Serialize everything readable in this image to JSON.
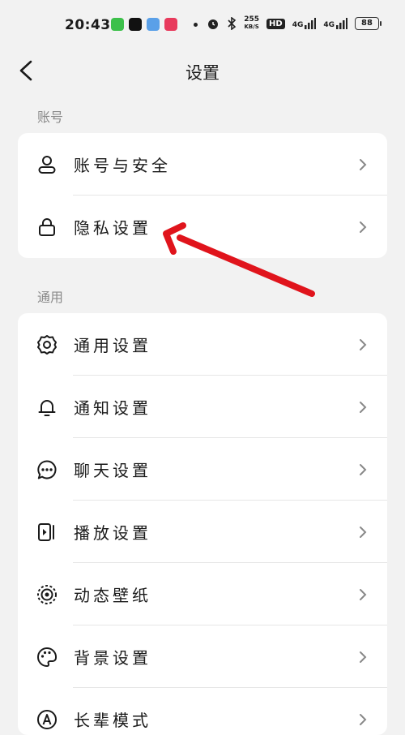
{
  "status_bar": {
    "time": "20:43",
    "net_speed_top": "255",
    "net_speed_bottom": "KB/S",
    "hd_label": "HD",
    "signal1": "4G",
    "signal2": "4G",
    "battery": "88"
  },
  "nav": {
    "title": "设置"
  },
  "sections": [
    {
      "label": "账号",
      "items": [
        {
          "label": "账号与安全",
          "icon": "person-icon"
        },
        {
          "label": "隐私设置",
          "icon": "lock-icon"
        }
      ]
    },
    {
      "label": "通用",
      "items": [
        {
          "label": "通用设置",
          "icon": "gear-icon"
        },
        {
          "label": "通知设置",
          "icon": "bell-icon"
        },
        {
          "label": "聊天设置",
          "icon": "chat-icon"
        },
        {
          "label": "播放设置",
          "icon": "play-panel-icon"
        },
        {
          "label": "动态壁纸",
          "icon": "target-icon"
        },
        {
          "label": "背景设置",
          "icon": "palette-icon"
        },
        {
          "label": "长辈模式",
          "icon": "a-circle-icon"
        }
      ]
    }
  ],
  "colors": {
    "accent_arrow": "#e0141c",
    "background": "#f2f2f2",
    "card": "#ffffff"
  }
}
